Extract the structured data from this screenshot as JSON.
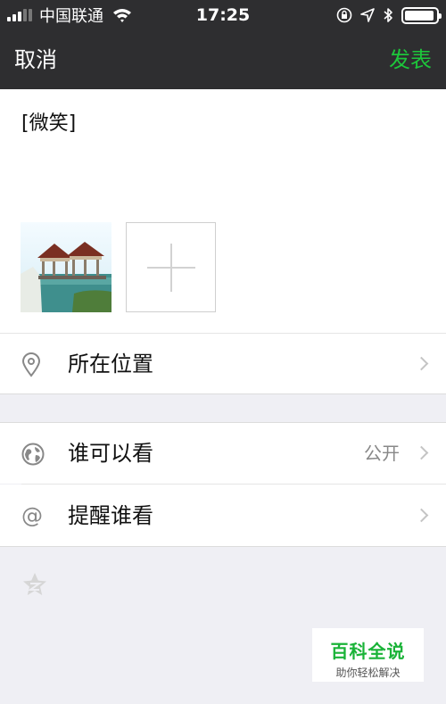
{
  "status_bar": {
    "carrier": "中国联通",
    "time": "17:25",
    "icons": [
      "signal-icon",
      "wifi-icon",
      "orientation-lock-icon",
      "location-arrow-icon",
      "bluetooth-icon",
      "battery-icon"
    ],
    "battery_level": 0.95
  },
  "nav": {
    "cancel_label": "取消",
    "post_label": "发表",
    "post_color": "#1dc63b"
  },
  "compose": {
    "text": "[微笑]",
    "photo_icon": "pavilion-photo",
    "add_photo_icon": "plus-icon"
  },
  "settings": {
    "location": {
      "label": "所在位置",
      "icon": "location-pin-icon"
    },
    "visibility": {
      "label": "谁可以看",
      "value": "公开",
      "icon": "globe-icon"
    },
    "remind": {
      "label": "提醒谁看",
      "icon": "at-icon",
      "glyph": "@"
    }
  },
  "watermark": {
    "title": "百科全说",
    "subtitle": "助你轻松解决"
  }
}
